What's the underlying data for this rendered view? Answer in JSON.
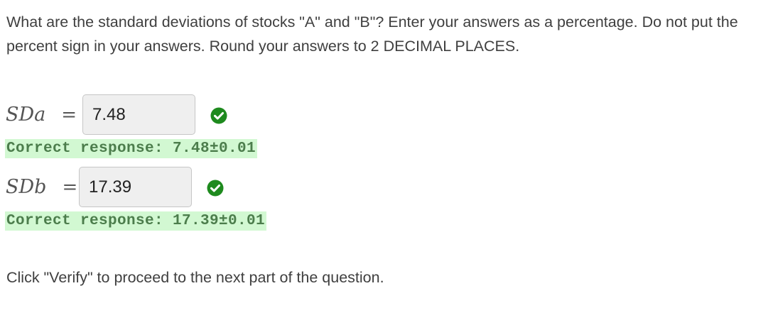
{
  "question": "What are the standard deviations of stocks \"A\" and \"B\"? Enter your answers as a percentage. Do not put the percent sign in your answers. Round your answers to 2 DECIMAL PLACES.",
  "answers": [
    {
      "label_main": "SD",
      "label_sub": "a",
      "equals": "=",
      "value": "7.48",
      "status_icon": "check-circle-icon",
      "feedback": "Correct response: 7.48±0.01"
    },
    {
      "label_main": "SD",
      "label_sub": "b",
      "equals": "=",
      "value": "17.39",
      "status_icon": "check-circle-icon",
      "feedback": "Correct response: 17.39±0.01"
    }
  ],
  "footer": "Click \"Verify\" to proceed to the next part of the question.",
  "colors": {
    "correct_icon": "#1e8a1e",
    "feedback_bg": "#d2f8d2",
    "feedback_text": "#4c7d4c"
  }
}
